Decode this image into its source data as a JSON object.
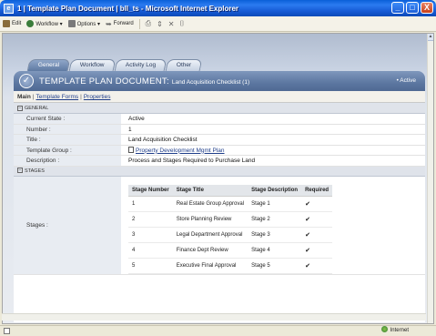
{
  "window": {
    "title": "1 | Template Plan Document | bll_ts - Microsoft Internet Explorer",
    "buttons": [
      "_",
      "□",
      "X"
    ]
  },
  "toolbar": {
    "edit": "Edit",
    "workflow": "Workflow ▾",
    "options": "Options ▾",
    "forward": "Forward"
  },
  "tabs": [
    {
      "label": "General",
      "active": true
    },
    {
      "label": "Workflow",
      "active": false
    },
    {
      "label": "Activity Log",
      "active": false
    },
    {
      "label": "Other",
      "active": false
    }
  ],
  "header": {
    "title": "TEMPLATE PLAN DOCUMENT: ",
    "subtitle": "Land Acquisition Checklist (1)",
    "status": "• Active"
  },
  "subnav": {
    "main": "Main",
    "template_forms": "Template Forms",
    "properties": "Properties"
  },
  "general": {
    "section_label": "GENERAL",
    "fields": [
      {
        "label": "Current State :",
        "value": "Active"
      },
      {
        "label": "Number :",
        "value": "1"
      },
      {
        "label": "Title :",
        "value": "Land Acquisition Checklist"
      },
      {
        "label": "Template Group :",
        "value": "Property Development Mgmt Plan"
      },
      {
        "label": "Description :",
        "value": "Process and Stages Required to Purchase Land"
      }
    ]
  },
  "stages": {
    "section_label": "STAGES",
    "label": "Stages :",
    "columns": [
      "Stage Number",
      "Stage Title",
      "Stage Description",
      "Required"
    ],
    "rows": [
      [
        "1",
        "Real Estate Group Approval",
        "Stage 1",
        "✔"
      ],
      [
        "2",
        "Store Planning Review",
        "Stage 2",
        "✔"
      ],
      [
        "3",
        "Legal Department Approval",
        "Stage 3",
        "✔"
      ],
      [
        "4",
        "Finance Dept Review",
        "Stage 4",
        "✔"
      ],
      [
        "5",
        "Executive Final Approval",
        "Stage 5",
        "✔"
      ]
    ]
  },
  "statusbar": {
    "zone": "Internet"
  },
  "colors": {
    "titlebar": "#1559D4",
    "header_band": "#5C77A1",
    "link": "#1F3E8A"
  }
}
